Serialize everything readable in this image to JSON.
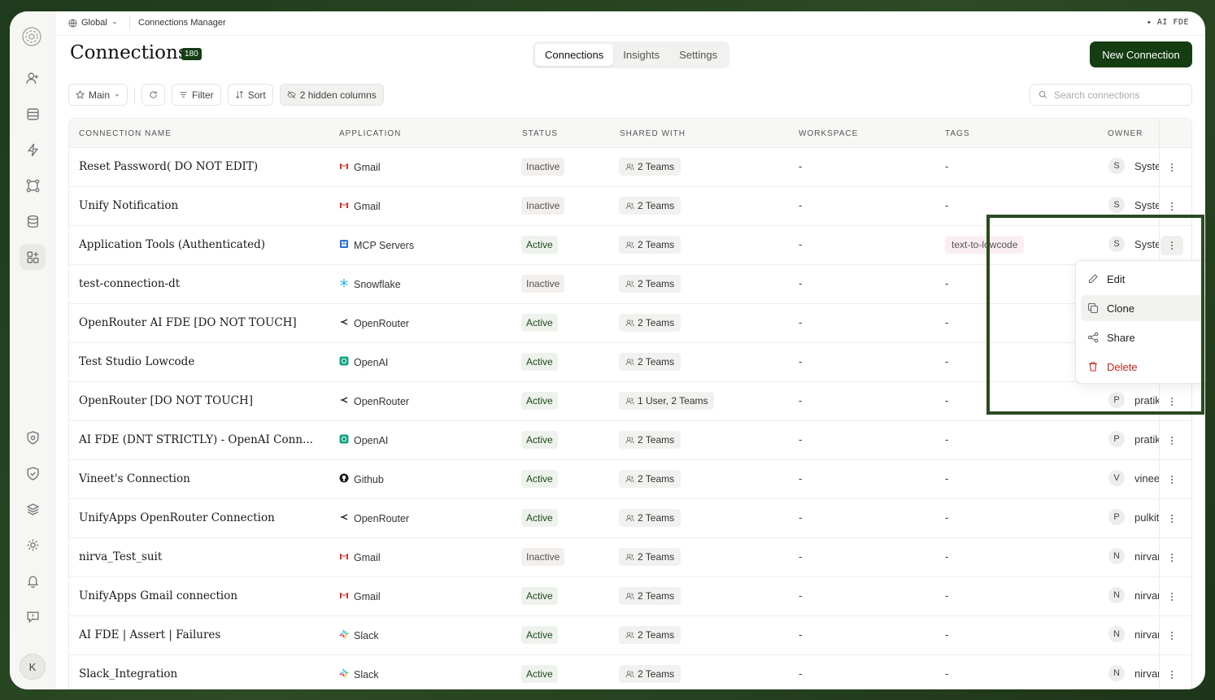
{
  "topbar": {
    "scope": "Global",
    "page": "Connections Manager",
    "ai_label": "AI FDE"
  },
  "header": {
    "title": "Connections",
    "count": "180",
    "tabs": [
      "Connections",
      "Insights",
      "Settings"
    ],
    "active_tab": "Connections",
    "new_button": "New Connection"
  },
  "toolbar": {
    "view": "Main",
    "filter": "Filter",
    "sort": "Sort",
    "hidden_columns": "2 hidden columns",
    "search_placeholder": "Search connections"
  },
  "columns": [
    "CONNECTION NAME",
    "APPLICATION",
    "STATUS",
    "SHARED WITH",
    "WORKSPACE",
    "TAGS",
    "OWNER"
  ],
  "rows": [
    {
      "name": "Reset Password( DO NOT EDIT)",
      "app": "Gmail",
      "app_icon": "gmail-icon",
      "status": "Inactive",
      "shared": "2 Teams",
      "workspace": "-",
      "tags": "-",
      "owner_initial": "S",
      "owner": "System"
    },
    {
      "name": "Unify Notification",
      "app": "Gmail",
      "app_icon": "gmail-icon",
      "status": "Inactive",
      "shared": "2 Teams",
      "workspace": "-",
      "tags": "-",
      "owner_initial": "S",
      "owner": "System"
    },
    {
      "name": "Application Tools (Authenticated)",
      "app": "MCP Servers",
      "app_icon": "mcp-icon",
      "status": "Active",
      "shared": "2 Teams",
      "workspace": "-",
      "tags": "text-to-lowcode",
      "owner_initial": "S",
      "owner": "System"
    },
    {
      "name": "test-connection-dt",
      "app": "Snowflake",
      "app_icon": "snowflake-icon",
      "status": "Inactive",
      "shared": "2 Teams",
      "workspace": "-",
      "tags": "-",
      "owner_initial": "",
      "owner": ""
    },
    {
      "name": "OpenRouter AI FDE [DO NOT TOUCH]",
      "app": "OpenRouter",
      "app_icon": "openrouter-icon",
      "status": "Active",
      "shared": "2 Teams",
      "workspace": "-",
      "tags": "-",
      "owner_initial": "",
      "owner": ""
    },
    {
      "name": "Test Studio Lowcode",
      "app": "OpenAI",
      "app_icon": "openai-icon",
      "status": "Active",
      "shared": "2 Teams",
      "workspace": "-",
      "tags": "-",
      "owner_initial": "",
      "owner": ""
    },
    {
      "name": "OpenRouter [DO NOT TOUCH]",
      "app": "OpenRouter",
      "app_icon": "openrouter-icon",
      "status": "Active",
      "shared": "1 User, 2 Teams",
      "workspace": "-",
      "tags": "-",
      "owner_initial": "P",
      "owner": "pratik"
    },
    {
      "name": "AI FDE (DNT STRICTLY) - OpenAI Conn...",
      "app": "OpenAI",
      "app_icon": "openai-icon",
      "status": "Active",
      "shared": "2 Teams",
      "workspace": "-",
      "tags": "-",
      "owner_initial": "P",
      "owner": "pratik"
    },
    {
      "name": "Vineet's Connection",
      "app": "Github",
      "app_icon": "github-icon",
      "status": "Active",
      "shared": "2 Teams",
      "workspace": "-",
      "tags": "-",
      "owner_initial": "V",
      "owner": "vineet"
    },
    {
      "name": "UnifyApps OpenRouter Connection",
      "app": "OpenRouter",
      "app_icon": "openrouter-icon",
      "status": "Active",
      "shared": "2 Teams",
      "workspace": "-",
      "tags": "-",
      "owner_initial": "P",
      "owner": "pulkit"
    },
    {
      "name": "nirva_Test_suit",
      "app": "Gmail",
      "app_icon": "gmail-icon",
      "status": "Inactive",
      "shared": "2 Teams",
      "workspace": "-",
      "tags": "-",
      "owner_initial": "N",
      "owner": "nirvan"
    },
    {
      "name": "UnifyApps Gmail connection",
      "app": "Gmail",
      "app_icon": "gmail-icon",
      "status": "Active",
      "shared": "2 Teams",
      "workspace": "-",
      "tags": "-",
      "owner_initial": "N",
      "owner": "nirvan"
    },
    {
      "name": "AI FDE | Assert | Failures",
      "app": "Slack",
      "app_icon": "slack-icon",
      "status": "Active",
      "shared": "2 Teams",
      "workspace": "-",
      "tags": "-",
      "owner_initial": "N",
      "owner": "nirvan"
    },
    {
      "name": "Slack_Integration",
      "app": "Slack",
      "app_icon": "slack-icon",
      "status": "Active",
      "shared": "2 Teams",
      "workspace": "-",
      "tags": "-",
      "owner_initial": "N",
      "owner": "nirvan"
    }
  ],
  "context_menu": {
    "items": [
      {
        "label": "Edit",
        "icon": "pencil-icon"
      },
      {
        "label": "Clone",
        "icon": "copy-icon"
      },
      {
        "label": "Share",
        "icon": "share-icon"
      },
      {
        "label": "Delete",
        "icon": "trash-icon"
      }
    ]
  },
  "user": {
    "initial": "K"
  },
  "colors": {
    "brand": "#143d12",
    "danger": "#c0261e",
    "active_bg": "#eef2ec",
    "tag_bg": "#fbeef2"
  }
}
